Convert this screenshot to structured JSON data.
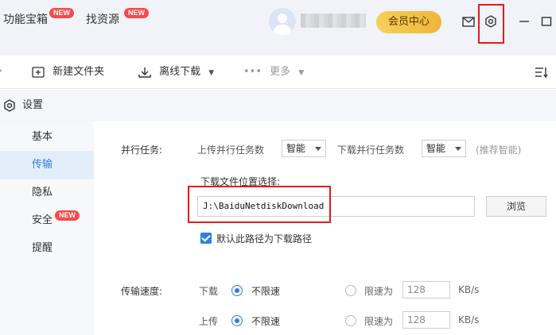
{
  "topbar": {
    "tab_toolbox": "功能宝箱",
    "tab_find": "找资源",
    "new_badge": "NEW",
    "vip_label": "会员中心"
  },
  "toolbar": {
    "new_folder": "新建文件夹",
    "offline_download": "离线下载",
    "more": "更多"
  },
  "settings": {
    "title": "设置",
    "menu": [
      "基本",
      "传输",
      "隐私",
      "安全",
      "提醒"
    ],
    "active_menu": "传输"
  },
  "transfer": {
    "parallel_label": "并行任务:",
    "upload_parallel_label": "上传并行任务数",
    "upload_parallel_value": "智能",
    "download_parallel_label": "下载并行任务数",
    "download_parallel_value": "智能",
    "recommend_hint": "(推荐智能)",
    "download_location_label": "下载文件位置选择:",
    "download_path": "J:\\BaiduNetdiskDownload",
    "browse_label": "浏览",
    "default_path_label": "默认此路径为下载路径",
    "speed_label": "传输速度:",
    "download_label": "下载",
    "upload_label": "上传",
    "unlimited_label": "不限速",
    "limit_label": "限速为",
    "download_limit_value": "128",
    "upload_limit_value": "128",
    "unit": "KB/s"
  },
  "colors": {
    "accent": "#2f7de1",
    "highlight": "#e8191b",
    "badge": "#f44b4b",
    "vip": "#f0b53a"
  }
}
